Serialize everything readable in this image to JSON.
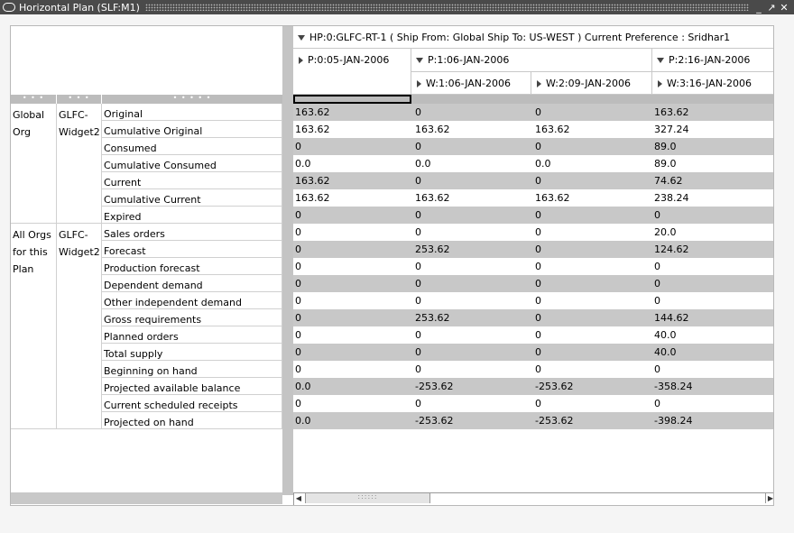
{
  "window": {
    "title": "Horizontal Plan (SLF:M1)"
  },
  "header": {
    "plan": "HP:0:GLFC-RT-1  ( Ship From: Global  Ship To: US-WEST )   Current Preference : Sridhar1",
    "periods": [
      "P:0:05-JAN-2006",
      "P:1:06-JAN-2006",
      "P:2:16-JAN-2006"
    ],
    "weeks": [
      "W:1:06-JAN-2006",
      "W:2:09-JAN-2006",
      "W:3:16-JAN-2006"
    ]
  },
  "groups": [
    {
      "org": [
        "Global",
        "Org"
      ],
      "item": [
        "GLFC-",
        "Widget2"
      ]
    },
    {
      "org": [
        "All Orgs",
        "for this",
        "Plan"
      ],
      "item": [
        "GLFC-",
        "Widget2"
      ]
    }
  ],
  "rows": [
    {
      "label": "Original",
      "values": [
        "163.62",
        "0",
        "0",
        "163.62"
      ]
    },
    {
      "label": "Cumulative Original",
      "values": [
        "163.62",
        "163.62",
        "163.62",
        "327.24"
      ]
    },
    {
      "label": "Consumed",
      "values": [
        "0",
        "0",
        "0",
        "89.0"
      ]
    },
    {
      "label": "Cumulative Consumed",
      "values": [
        "0.0",
        "0.0",
        "0.0",
        "89.0"
      ]
    },
    {
      "label": "Current",
      "values": [
        "163.62",
        "0",
        "0",
        "74.62"
      ]
    },
    {
      "label": "Cumulative Current",
      "values": [
        "163.62",
        "163.62",
        "163.62",
        "238.24"
      ]
    },
    {
      "label": "Expired",
      "values": [
        "0",
        "0",
        "0",
        "0"
      ]
    },
    {
      "label": "Sales orders",
      "values": [
        "0",
        "0",
        "0",
        "20.0"
      ]
    },
    {
      "label": "Forecast",
      "values": [
        "0",
        "253.62",
        "0",
        "124.62"
      ]
    },
    {
      "label": "Production forecast",
      "values": [
        "0",
        "0",
        "0",
        "0"
      ]
    },
    {
      "label": "Dependent demand",
      "values": [
        "0",
        "0",
        "0",
        "0"
      ]
    },
    {
      "label": "Other independent demand",
      "values": [
        "0",
        "0",
        "0",
        "0"
      ]
    },
    {
      "label": "Gross requirements",
      "values": [
        "0",
        "253.62",
        "0",
        "144.62"
      ]
    },
    {
      "label": "Planned orders",
      "values": [
        "0",
        "0",
        "0",
        "40.0"
      ]
    },
    {
      "label": "Total supply",
      "values": [
        "0",
        "0",
        "0",
        "40.0"
      ]
    },
    {
      "label": "Beginning on hand",
      "values": [
        "0",
        "0",
        "0",
        "0"
      ]
    },
    {
      "label": "Projected available balance",
      "values": [
        "0.0",
        "-253.62",
        "-253.62",
        "-358.24"
      ]
    },
    {
      "label": "Current scheduled receipts",
      "values": [
        "0",
        "0",
        "0",
        "0"
      ]
    },
    {
      "label": "Projected on hand",
      "values": [
        "0.0",
        "-253.62",
        "-253.62",
        "-398.24"
      ]
    }
  ],
  "colors": {
    "shaded_row": "#c8c8c8",
    "titlebar": "#4a4a4a"
  }
}
